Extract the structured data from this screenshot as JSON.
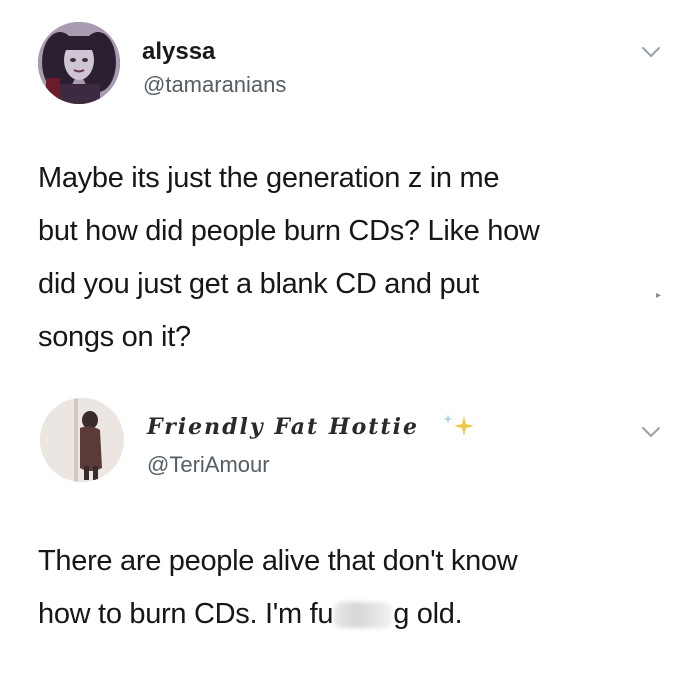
{
  "tweets": [
    {
      "display_name": "alyssa",
      "handle": "@tamaranians",
      "body_lines": [
        "Maybe its just the generation z in me",
        "but how did people burn CDs? Like how",
        "did you just get a blank CD and put",
        "songs on it?"
      ]
    },
    {
      "display_name": "Friendly Fat Hottie",
      "handle": "@TeriAmour",
      "body_lines": [
        "There are people alive that don't know"
      ],
      "body_last_line_prefix": "how to burn CDs. I'm fu",
      "body_last_line_suffix": "g old."
    }
  ],
  "icons": {
    "menu": "chevron-down-icon",
    "sparkle": "sparkle-icon",
    "side_mark": "▸"
  },
  "colors": {
    "text": "#171717",
    "handle": "#555d66",
    "chevron": "#9aa3ab",
    "sparkle": "#f0c94a"
  }
}
